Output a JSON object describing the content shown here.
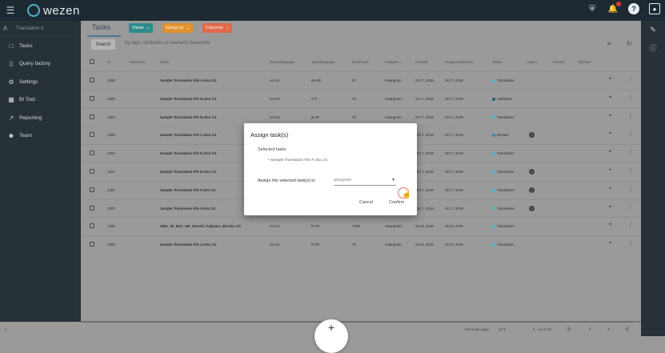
{
  "topbar": {
    "logo_text": "wezen",
    "icons": [
      "shield-icon",
      "notifications-icon",
      "help-icon",
      "user-menu-icon"
    ]
  },
  "sidebar": {
    "project": "Translation A",
    "items": [
      {
        "label": "Tasks",
        "icon": "folder-icon"
      },
      {
        "label": "Query factory",
        "icon": "bar-chart-icon"
      },
      {
        "label": "Settings",
        "icon": "gear-icon"
      },
      {
        "label": "BI Tool",
        "icon": "bi-icon"
      },
      {
        "label": "Reporting",
        "icon": "trend-icon"
      },
      {
        "label": "Team",
        "icon": "group-icon"
      }
    ]
  },
  "header": {
    "tab": "Tasks",
    "chips": [
      {
        "label": "Views",
        "color": "#2e8b8b"
      },
      {
        "label": "Group by",
        "color": "#e0922b"
      },
      {
        "label": "Columns",
        "color": "#e06a4a"
      }
    ]
  },
  "search": {
    "button": "Search",
    "placeholder": "by tags, attributes or research keywords"
  },
  "table": {
    "columns": [
      "Id",
      "ExternalId",
      "Name",
      "Sourcelanguage",
      "Targetlanguage",
      "Wordcount",
      "Assignee",
      "Created",
      "Suggesteddelivery",
      "Status",
      "Urgent",
      "Deleted",
      "Blocked"
    ],
    "rows": [
      {
        "id": "1299",
        "name": "Sample Translation File A.xlsx 1/1",
        "src": "en-US",
        "tgt": "de-DE",
        "wc": "57",
        "assignee": "msargento",
        "created": "Oct 7, 2019",
        "delivery": "Oct 7, 2019",
        "status": "Translation",
        "status_color": "#4fb3c9",
        "urgent": false
      },
      {
        "id": "1300",
        "name": "Sample Translation File B.xlsx 1/1",
        "src": "en-US",
        "tgt": "it-IT",
        "wc": "75",
        "assignee": "msargento",
        "created": "Oct 7, 2019",
        "delivery": "Oct 7, 2019",
        "status": "Validation",
        "status_color": "#1f5b6e",
        "urgent": false
      },
      {
        "id": "1303",
        "name": "Sample Translation File B.xlsx 1/1",
        "src": "en-US",
        "tgt": "ja-JP",
        "wc": "75",
        "assignee": "msargento",
        "created": "Oct 7, 2019",
        "delivery": "Oct 7, 2019",
        "status": "Translation",
        "status_color": "#4fb3c9",
        "urgent": false
      },
      {
        "id": "1305",
        "name": "Sample Translation File C.xlsx 1/1",
        "src": "",
        "tgt": "",
        "wc": "",
        "assignee": "",
        "created": "Oct 7, 2019",
        "delivery": "Oct 7, 2019",
        "status": "Review",
        "status_color": "#3b87a8",
        "urgent": true
      },
      {
        "id": "1312",
        "name": "Sample Translation File D.xlsx 1/1",
        "src": "",
        "tgt": "",
        "wc": "",
        "assignee": "",
        "created": "Oct 7, 2019",
        "delivery": "Oct 7, 2019",
        "status": "Translation",
        "status_color": "#4fb3c9",
        "urgent": false
      },
      {
        "id": "1317",
        "name": "Sample Translation File E.xlsx 1/1",
        "src": "",
        "tgt": "",
        "wc": "",
        "assignee": "",
        "created": "Oct 7, 2019",
        "delivery": "Oct 7, 2019",
        "status": "Translation",
        "status_color": "#4fb3c9",
        "urgent": true
      },
      {
        "id": "1322",
        "name": "Sample Translation File F.xlsx 1/1",
        "src": "",
        "tgt": "",
        "wc": "",
        "assignee": "",
        "created": "Oct 7, 2019",
        "delivery": "Oct 7, 2019",
        "status": "Translation",
        "status_color": "#4fb3c9",
        "urgent": true
      },
      {
        "id": "1323",
        "name": "Sample Translation File F.xlsx 1/1",
        "src": "",
        "tgt": "",
        "wc": "",
        "assignee": "",
        "created": "Oct 7, 2019",
        "delivery": "Oct 7, 2019",
        "status": "Translation",
        "status_color": "#4fb3c9",
        "urgent": true
      },
      {
        "id": "1335",
        "name": "ABU_JP_EXC_MF_Hiroshi_Fujiwara_EN.xlsx 1/1",
        "src": "en-US",
        "tgt": "fr-FR",
        "wc": "7298",
        "assignee": "msargento",
        "created": "Oct 8, 2019",
        "delivery": "Oct 8, 2019",
        "status": "Translation",
        "status_color": "#4fb3c9",
        "urgent": false
      },
      {
        "id": "1350",
        "name": "Sample Translation File X.xlsx 1/1",
        "src": "en-US",
        "tgt": "fr-FR",
        "wc": "75",
        "assignee": "msargento",
        "created": "Oct 8, 2019",
        "delivery": "Oct 8, 2019",
        "status": "Translation",
        "status_color": "#4fb3c9",
        "urgent": false
      }
    ]
  },
  "pagination": {
    "items_per_page_label": "Items per page:",
    "items_per_page": "10",
    "range": "1 - 10 of 16"
  },
  "dialog": {
    "title": "Assign task(s)",
    "selected_label": "Selected tasks",
    "selected_item": "Sample Translation File F.xlsx 1/1",
    "assign_label": "Assign the selected task(s) to",
    "assign_placeholder": "assignee",
    "cancel": "Cancel",
    "confirm": "Confirm"
  }
}
